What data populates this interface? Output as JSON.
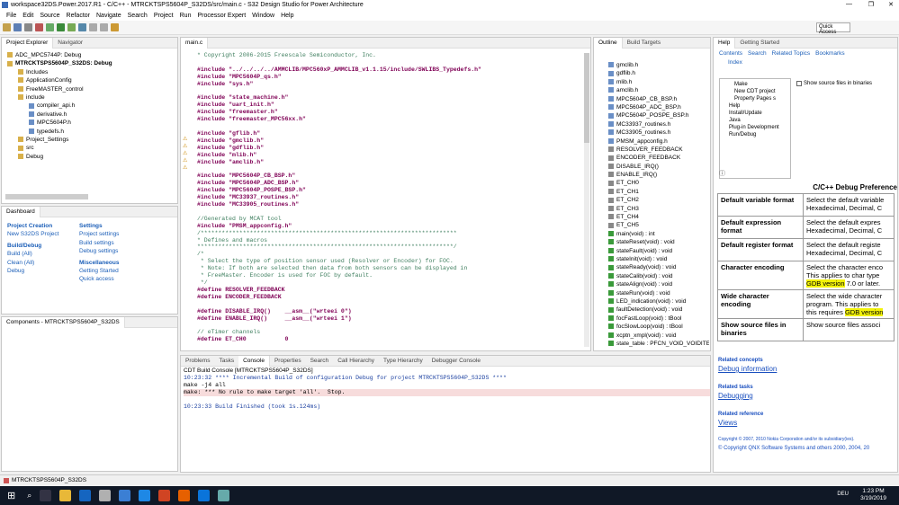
{
  "window": {
    "title": "workspace32DS.Power.2017.R1 - C/C++ - MTRCKTSPS5604P_S32DS/src/main.c - S32 Design Studio for Power Architecture"
  },
  "menu": [
    "File",
    "Edit",
    "Source",
    "Refactor",
    "Navigate",
    "Search",
    "Project",
    "Run",
    "Processor Expert",
    "Window",
    "Help"
  ],
  "toolbar": {
    "quick_access": "Quick Access"
  },
  "project_explorer": {
    "tabs": [
      "Project Explorer",
      "Navigator"
    ],
    "items": [
      "ADC_MPC5744P: Debug",
      "MTRCKTSPS5604P_S32DS: Debug",
      "Includes",
      "ApplicationConfig",
      "FreeMASTER_control",
      "include",
      "compiler_api.h",
      "derivative.h",
      "MPC5604P.h",
      "typedefs.h",
      "Project_Settings",
      "src",
      "Debug"
    ]
  },
  "dashboard": {
    "title": "Dashboard",
    "project_creation": {
      "title": "Project Creation",
      "items": [
        "New S32DS Project"
      ]
    },
    "settings": {
      "title": "Settings",
      "items": [
        "Project settings",
        "Build settings",
        "Debug settings"
      ]
    },
    "build_debug": {
      "title": "Build/Debug",
      "items": [
        "Build (All)",
        "Clean (All)",
        "Debug"
      ]
    },
    "misc": {
      "title": "Miscellaneous",
      "items": [
        "Getting Started",
        "Quick access"
      ]
    }
  },
  "components": {
    "title": "Components - MTRCKTSPS5604P_S32DS"
  },
  "editor": {
    "tab": "main.c",
    "lines": [
      "* Copyright 2006-2015 Freescale Semiconductor, Inc.",
      "",
      "#include \"../../../../AMMCLIB/MPC560xP_AMMCLIB_v1.1.15/include/SWLIBS_Typedefs.h\"",
      "#include \"MPC5604P_qs.h\"",
      "#include \"sys.h\"",
      "",
      "#include \"state_machine.h\"",
      "#include \"uart_init.h\"",
      "#include \"freemaster.h\"",
      "#include \"freemaster_MPC56xx.h\"",
      "",
      "#include \"gflib.h\"",
      "#include \"gmclib.h\"",
      "#include \"gdflib.h\"",
      "#include \"mlib.h\"",
      "#include \"amclib.h\"",
      "",
      "#include \"MPC5604P_CB_BSP.h\"",
      "#include \"MPC5604P_ADC_BSP.h\"",
      "#include \"MPC5604P_POSPE_BSP.h\"",
      "#include \"MC33937_routines.h\"",
      "#include \"MC33905_routines.h\"",
      "",
      "//Generated by MCAT tool",
      "#include \"PMSM_appconfig.h\"",
      "/*************************************************************************",
      "* Defines and macros",
      "*************************************************************************/",
      "/*",
      " * Select the type of position sensor used (Resolver or Encoder) for FOC.",
      " * Note: If both are selected then data from both sensors can be displayed in",
      " * FreeMaster. Encoder is used for FOC by default.",
      " */",
      "#define RESOLVER_FEEDBACK",
      "#define ENCODER_FEEDBACK",
      "",
      "#define DISABLE_IRQ()    __asm__(\"wrteei 0\")",
      "#define ENABLE_IRQ()     __asm__(\"wrteei 1\")",
      "",
      "// eTimer channels",
      "#define ET_CH0           0"
    ]
  },
  "outline": {
    "tabs": [
      "Outline",
      "Build Targets"
    ],
    "items": [
      "gmclib.h",
      "gdflib.h",
      "mlib.h",
      "amclib.h",
      "MPC5604P_CB_BSP.h",
      "MPC5604P_ADC_BSP.h",
      "MPC5604P_POSPE_BSP.h",
      "MC33937_routines.h",
      "MC33905_routines.h",
      "PMSM_appconfig.h",
      "RESOLVER_FEEDBACK",
      "ENCODER_FEEDBACK",
      "DISABLE_IRQ()",
      "ENABLE_IRQ()",
      "ET_CH0",
      "ET_CH1",
      "ET_CH2",
      "ET_CH3",
      "ET_CH4",
      "ET_CH5",
      "main(void) : int",
      "stateReset(void) : void",
      "stateFault(void) : void",
      "stateInit(void) : void",
      "stateReady(void) : void",
      "stateCalib(void) : void",
      "stateAlign(void) : void",
      "stateRun(void) : void",
      "LED_indication(void) : void",
      "faultDetection(void) : void",
      "focFastLoop(void) : tBool",
      "focSlowLoop(void) : tBool",
      "xcptn_xmpl(void) : void",
      "state_table : PFCN_VOID_VOIDITEST"
    ]
  },
  "console": {
    "tabs": [
      "Problems",
      "Tasks",
      "Console",
      "Properties",
      "Search",
      "Call Hierarchy",
      "Type Hierarchy",
      "Debugger Console"
    ],
    "title": "CDT Build Console [MTRCKTSPS5604P_S32DS]",
    "lines": [
      "10:23:32 **** Incremental Build of configuration Debug for project MTRCKTSPS5604P_S32DS ****",
      "make -j4 all",
      "make: *** No rule to make target 'all'.  Stop.",
      "",
      "10:23:33 Build Finished (took 1s.124ms)"
    ]
  },
  "help": {
    "tabs": [
      "Help",
      "Getting Started"
    ],
    "nav": [
      "Contents",
      "Search",
      "Related Topics",
      "Bookmarks",
      "Index"
    ],
    "tree": [
      "Make",
      "New CDT project",
      "Property Pages s",
      "Help",
      "Install/Update",
      "Java",
      "Plug-in Development",
      "Run/Debug"
    ],
    "checkbox": "Show source files in binaries",
    "heading": "C/C++ Debug Preference",
    "rows": [
      {
        "k": "Default variable format",
        "v": "Select the default variable Hexadecimal, Decimal, C"
      },
      {
        "k": "Default expression format",
        "v": "Select the default expres Hexadecimal, Decimal, C"
      },
      {
        "k": "Default register format",
        "v": "Select the default registe Hexadecimal, Decimal, C"
      },
      {
        "k": "Character encoding",
        "v1": "Select the character enco This applies to char type",
        "hl": "GDB version",
        "v2": "7.0 or later."
      },
      {
        "k": "Wide character encoding",
        "v1": "Select the wide character program. This applies to",
        "hl2": "this requires",
        "hl3": "GDB version"
      },
      {
        "k": "Show source files in binaries",
        "v": "Show source files associ"
      }
    ],
    "related_concepts": "Related concepts",
    "rc_link": "Debug information",
    "related_tasks": "Related tasks",
    "rt_link": "Debugging",
    "related_ref": "Related reference",
    "rr_link": "Views",
    "copyright1": "Copyright © 2007, 2010 Nokia Corporation and/or its subsidiary(ies).",
    "copyright2": "© Copyright QNX Software Systems and others 2000, 2004, 20"
  },
  "status": {
    "left": "MTRCKTSPS5604P_S32DS"
  },
  "taskbar": {
    "time": "1:23 PM",
    "date": "3/19/2019",
    "lang": "DEU"
  }
}
